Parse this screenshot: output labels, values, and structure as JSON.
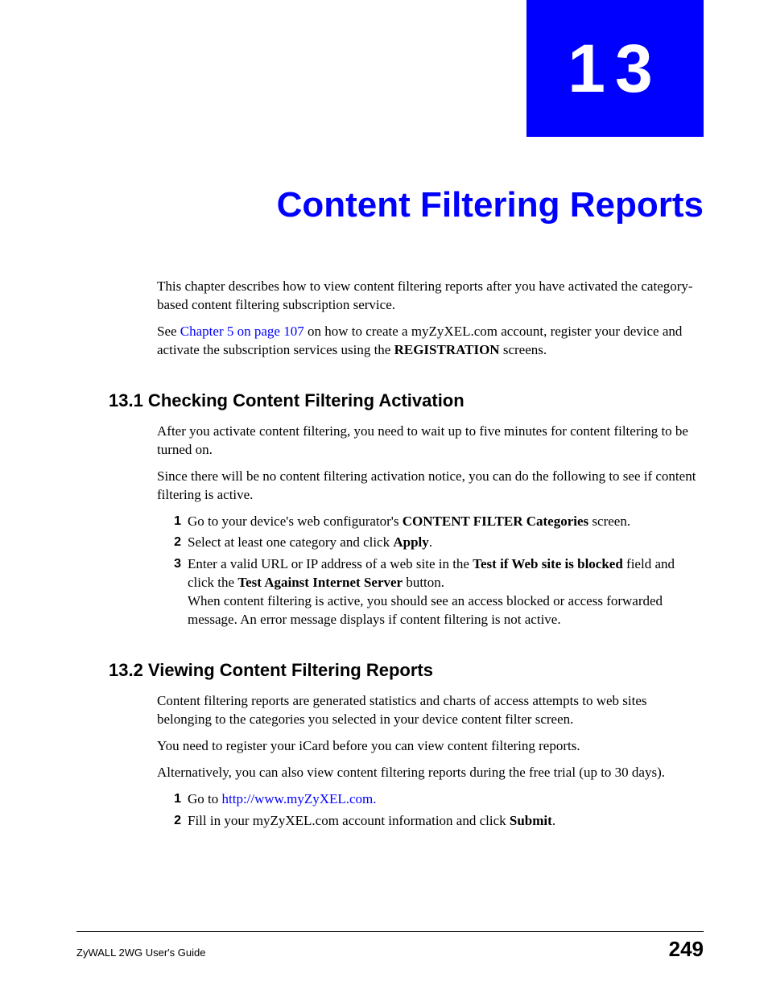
{
  "chapter": {
    "number": "13",
    "title": "Content Filtering Reports"
  },
  "intro": {
    "p1": "This chapter describes how to view content filtering reports after you have activated the category-based content filtering subscription service.",
    "p2_prefix": "See ",
    "p2_link": "Chapter 5 on page 107",
    "p2_mid": " on how to create a myZyXEL.com account, register your device and activate the subscription services using the ",
    "p2_bold": "REGISTRATION",
    "p2_suffix": " screens."
  },
  "section1": {
    "heading": "13.1  Checking Content Filtering Activation",
    "p1": "After you activate content filtering, you need to wait up to five minutes for content filtering to be turned on.",
    "p2": "Since there will be no content filtering activation notice, you can do the following to see if content filtering is active.",
    "steps": [
      {
        "num": "1",
        "prefix": "Go to your device's web configurator's ",
        "bold1": "CONTENT FILTER Categories",
        "suffix": " screen."
      },
      {
        "num": "2",
        "prefix": "Select at least one category and click ",
        "bold1": "Apply",
        "suffix": "."
      },
      {
        "num": "3",
        "prefix": "Enter a valid URL or IP address of a web site in the ",
        "bold1": "Test if Web site is blocked",
        "mid1": " field and click the ",
        "bold2": "Test Against Internet Server",
        "mid2": " button.",
        "line2": "When content filtering is active, you should see an access blocked or access forwarded message. An error message displays if content filtering is not active."
      }
    ]
  },
  "section2": {
    "heading": "13.2  Viewing Content Filtering Reports",
    "p1": "Content filtering reports are generated statistics and charts of access attempts to web sites belonging to the categories you selected in your device content filter screen.",
    "p2": "You need to register your iCard before you can view content filtering reports.",
    "p3": "Alternatively, you can also view content filtering reports during the free trial (up to 30 days).",
    "steps": [
      {
        "num": "1",
        "prefix": "Go to ",
        "link": "http://www.myZyXEL.com.",
        "suffix": ""
      },
      {
        "num": "2",
        "prefix": "Fill in your myZyXEL.com account information and click ",
        "bold1": "Submit",
        "suffix": "."
      }
    ]
  },
  "footer": {
    "guide": "ZyWALL 2WG User's Guide",
    "page": "249"
  }
}
